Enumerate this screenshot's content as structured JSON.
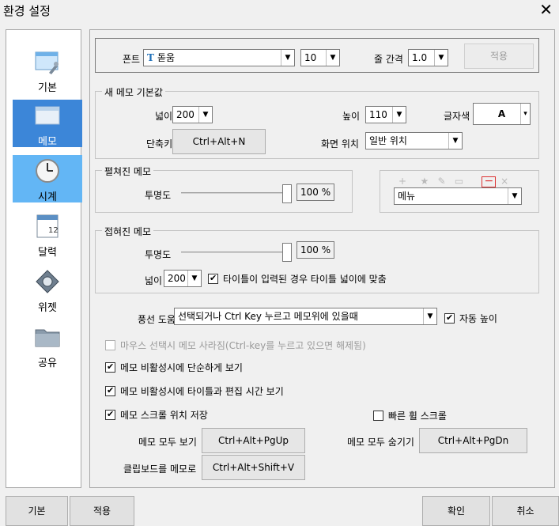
{
  "window": {
    "title": "환경 설정",
    "close": "✕"
  },
  "sidebar": {
    "items": [
      {
        "label": "기본"
      },
      {
        "label": "메모"
      },
      {
        "label": "시계"
      },
      {
        "label": "달력"
      },
      {
        "label": "위젯"
      },
      {
        "label": "공유"
      }
    ],
    "calendar_day": "12"
  },
  "font_row": {
    "font_label": "폰트",
    "font_value": "돋움",
    "font_icon_glyph": "T",
    "size_value": "10",
    "line_spacing_label": "줄 간격",
    "line_spacing_value": "1.0",
    "apply_label": "적용"
  },
  "new_memo": {
    "title": "새 메모 기본값",
    "width_label": "넓이",
    "width_value": "200",
    "height_label": "높이",
    "height_value": "110",
    "text_color_label": "글자색",
    "text_color_value": "A",
    "shortcut_label": "단축키",
    "shortcut_value": "Ctrl+Alt+N",
    "screen_pos_label": "화면 위치",
    "screen_pos_value": "일반 위치"
  },
  "expanded_memo": {
    "title": "펼쳐진 메모",
    "opacity_label": "투명도",
    "opacity_value": "100 %",
    "opacity_level": 1.0
  },
  "toolbar_preview": {
    "icons": [
      "+",
      "★",
      "✎",
      "▭"
    ],
    "minus": "−",
    "close": "×",
    "menu_value": "메뉴"
  },
  "collapsed_memo": {
    "title": "접혀진 메모",
    "opacity_label": "투명도",
    "opacity_value": "100 %",
    "opacity_level": 1.0,
    "width_label": "넓이",
    "width_value": "200",
    "fit_title_label": "타이틀이 입력된 경우 타이틀 넓이에 맞춤"
  },
  "balloon": {
    "label": "풍선 도움말",
    "value": "선택되거나 Ctrl Key 누르고  메모위에 있을때",
    "auto_height_label": "자동 높이"
  },
  "options": {
    "mouse_select": "마우스 선택시 메모 사라짐(Ctrl-key를 누르고 있으면 해제됨)",
    "simple_view": "메모 비활성시에 단순하게 보기",
    "title_time_view": "메모 비활성시에 타이틀과 편집 시간 보기",
    "scroll_save": "메모 스크롤 위치 저장",
    "fast_wheel": "빠른 휠 스크롤"
  },
  "hotkeys": {
    "show_all_label": "메모 모두 보기",
    "show_all_value": "Ctrl+Alt+PgUp",
    "hide_all_label": "메모 모두 숨기기",
    "hide_all_value": "Ctrl+Alt+PgDn",
    "clipboard_label": "클립보드를 메모로",
    "clipboard_value": "Ctrl+Alt+Shift+V"
  },
  "bottom": {
    "default_label": "기본",
    "apply_label": "적용",
    "ok_label": "확인",
    "cancel_label": "취소"
  },
  "colors": {
    "selected_bg": "#3c86d8",
    "highlight_bg": "#63b6f5",
    "red_accent": "#d33333"
  }
}
